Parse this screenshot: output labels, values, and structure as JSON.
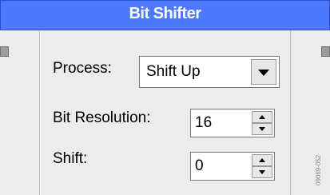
{
  "window": {
    "title": "Bit Shifter"
  },
  "process": {
    "label": "Process:",
    "selected": "Shift Up",
    "dropdown_icon": "chevron-down-icon"
  },
  "bit_resolution": {
    "label": "Bit Resolution:",
    "value": "16"
  },
  "shift": {
    "label": "Shift:",
    "value": "0"
  },
  "figure_code": "09069-052",
  "colors": {
    "titlebar": "#4d79ff",
    "panel": "#ececec"
  }
}
